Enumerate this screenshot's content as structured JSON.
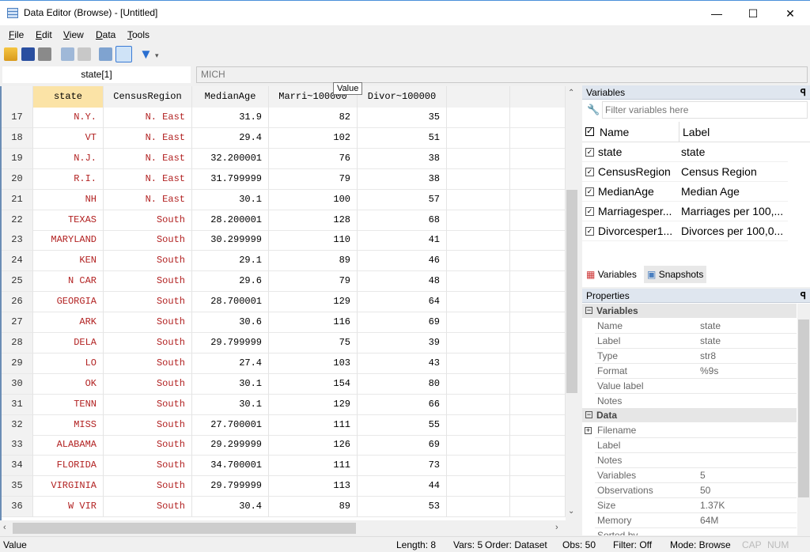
{
  "window": {
    "title": "Data Editor (Browse) - [Untitled]",
    "minimize": "—",
    "maximize": "☐",
    "close": "✕"
  },
  "menu": [
    "File",
    "Edit",
    "View",
    "Data",
    "Tools"
  ],
  "toolbar": [
    "open-icon",
    "save-icon",
    "print-icon",
    "copy-icon",
    "paste-icon",
    "edit-icon",
    "browse-icon",
    "filter-icon"
  ],
  "cellref": "state[1]",
  "cellvalue": "MICH",
  "tooltip": "Value",
  "grid": {
    "columns": [
      "state",
      "CensusRegion",
      "MedianAge",
      "Marri~100000",
      "Divor~100000"
    ],
    "rows": [
      [
        "17",
        "N.Y.",
        "N. East",
        "31.9",
        "82",
        "35"
      ],
      [
        "18",
        "VT",
        "N. East",
        "29.4",
        "102",
        "51"
      ],
      [
        "19",
        "N.J.",
        "N. East",
        "32.200001",
        "76",
        "38"
      ],
      [
        "20",
        "R.I.",
        "N. East",
        "31.799999",
        "79",
        "38"
      ],
      [
        "21",
        "NH",
        "N. East",
        "30.1",
        "100",
        "57"
      ],
      [
        "22",
        "TEXAS",
        "South",
        "28.200001",
        "128",
        "68"
      ],
      [
        "23",
        "MARYLAND",
        "South",
        "30.299999",
        "110",
        "41"
      ],
      [
        "24",
        "KEN",
        "South",
        "29.1",
        "89",
        "46"
      ],
      [
        "25",
        "N CAR",
        "South",
        "29.6",
        "79",
        "48"
      ],
      [
        "26",
        "GEORGIA",
        "South",
        "28.700001",
        "129",
        "64"
      ],
      [
        "27",
        "ARK",
        "South",
        "30.6",
        "116",
        "69"
      ],
      [
        "28",
        "DELA",
        "South",
        "29.799999",
        "75",
        "39"
      ],
      [
        "29",
        "LO",
        "South",
        "27.4",
        "103",
        "43"
      ],
      [
        "30",
        "OK",
        "South",
        "30.1",
        "154",
        "80"
      ],
      [
        "31",
        "TENN",
        "South",
        "30.1",
        "129",
        "66"
      ],
      [
        "32",
        "MISS",
        "South",
        "27.700001",
        "111",
        "55"
      ],
      [
        "33",
        "ALABAMA",
        "South",
        "29.299999",
        "126",
        "69"
      ],
      [
        "34",
        "FLORIDA",
        "South",
        "34.700001",
        "111",
        "73"
      ],
      [
        "35",
        "VIRGINIA",
        "South",
        "29.799999",
        "113",
        "44"
      ],
      [
        "36",
        "W VIR",
        "South",
        "30.4",
        "89",
        "53"
      ]
    ]
  },
  "variables_panel": {
    "title": "Variables",
    "pin": "ꟼ",
    "filter_placeholder": "Filter variables here",
    "col_name": "Name",
    "col_label": "Label",
    "items": [
      {
        "name": "state",
        "label": "state"
      },
      {
        "name": "CensusRegion",
        "label": "Census Region"
      },
      {
        "name": "MedianAge",
        "label": "Median Age"
      },
      {
        "name": "Marriagesper...",
        "label": "Marriages per 100,..."
      },
      {
        "name": "Divorcesper1...",
        "label": "Divorces per 100,0..."
      }
    ],
    "tab_variables": "Variables",
    "tab_snapshots": "Snapshots"
  },
  "properties_panel": {
    "title": "Properties",
    "sec_variables": "Variables",
    "variables": [
      [
        "Name",
        "state"
      ],
      [
        "Label",
        "state"
      ],
      [
        "Type",
        "str8"
      ],
      [
        "Format",
        "%9s"
      ],
      [
        "Value label",
        ""
      ],
      [
        "Notes",
        ""
      ]
    ],
    "sec_data": "Data",
    "data": [
      [
        "Filename",
        ""
      ],
      [
        "Label",
        ""
      ],
      [
        "Notes",
        ""
      ],
      [
        "Variables",
        "5"
      ],
      [
        "Observations",
        "50"
      ],
      [
        "Size",
        "1.37K"
      ],
      [
        "Memory",
        "64M"
      ],
      [
        "Sorted by",
        ""
      ]
    ]
  },
  "status": {
    "left": "Value",
    "length": "Length: 8",
    "vars": "Vars: 5",
    "order": "Order: Dataset",
    "obs": "Obs: 50",
    "filter": "Filter: Off",
    "mode": "Mode: Browse",
    "cap": "CAP",
    "num": "NUM"
  }
}
